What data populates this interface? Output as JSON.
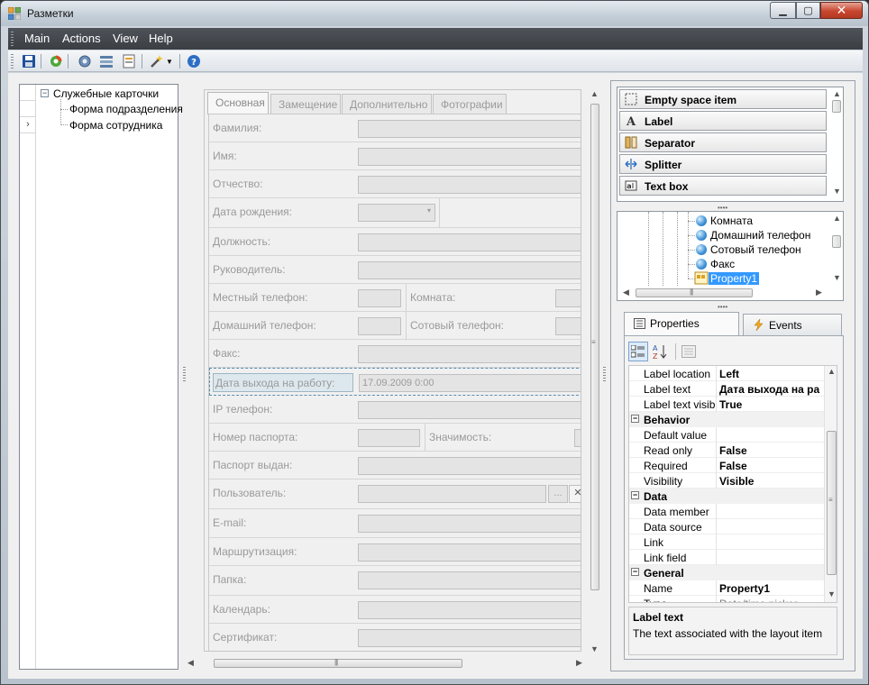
{
  "window": {
    "title": "Разметки"
  },
  "menu": [
    "Main",
    "Actions",
    "View",
    "Help"
  ],
  "tree": {
    "root": "Служебные карточки",
    "children": [
      "Форма подразделения",
      "Форма сотрудника"
    ]
  },
  "form": {
    "tabs": [
      "Основная",
      "Замещение",
      "Дополнительно",
      "Фотографии"
    ],
    "fields": {
      "surname": "Фамилия:",
      "name": "Имя:",
      "patronymic": "Отчество:",
      "birthdate": "Дата рождения:",
      "position": "Должность:",
      "manager": "Руководитель:",
      "local_phone": "Местный телефон:",
      "room": "Комната:",
      "home_phone": "Домашний телефон:",
      "mobile_phone": "Сотовый телефон:",
      "fax": "Факс:",
      "start_date": "Дата выхода на работу:",
      "start_date_value": "17.09.2009 0:00",
      "ip_phone": "IP телефон:",
      "passport_no": "Номер паспорта:",
      "significance": "Значимость:",
      "passport_issued": "Паспорт выдан:",
      "user": "Пользователь:",
      "email": "E-mail:",
      "routing": "Маршрутизация:",
      "folder": "Папка:",
      "calendar": "Календарь:",
      "certificate": "Сертификат:"
    },
    "browse_label": "..."
  },
  "toolbox": [
    "Empty space item",
    "Label",
    "Separator",
    "Splitter",
    "Text box"
  ],
  "hierarchy": {
    "items": [
      "Комната",
      "Домашний телефон",
      "Сотовый телефон",
      "Факс"
    ],
    "selected": "Property1"
  },
  "property_tabs": [
    "Properties",
    "Events"
  ],
  "properties": {
    "rows_top": [
      {
        "name": "Label location",
        "value": "Left"
      },
      {
        "name": "Label text",
        "value": "Дата выхода на ра"
      },
      {
        "name": "Label text visibl",
        "value": "True"
      }
    ],
    "behavior": {
      "title": "Behavior",
      "rows": [
        {
          "name": "Default value",
          "value": ""
        },
        {
          "name": "Read only",
          "value": "False"
        },
        {
          "name": "Required",
          "value": "False"
        },
        {
          "name": "Visibility",
          "value": "Visible"
        }
      ]
    },
    "data": {
      "title": "Data",
      "rows": [
        {
          "name": "Data member",
          "value": ""
        },
        {
          "name": "Data source",
          "value": ""
        },
        {
          "name": "Link",
          "value": ""
        },
        {
          "name": "Link field",
          "value": ""
        }
      ]
    },
    "general": {
      "title": "General",
      "rows": [
        {
          "name": "Name",
          "value": "Property1"
        },
        {
          "name": "Type",
          "value": "Date/time picker"
        }
      ]
    }
  },
  "description": {
    "title": "Label text",
    "text": "The text associated with the layout item"
  }
}
